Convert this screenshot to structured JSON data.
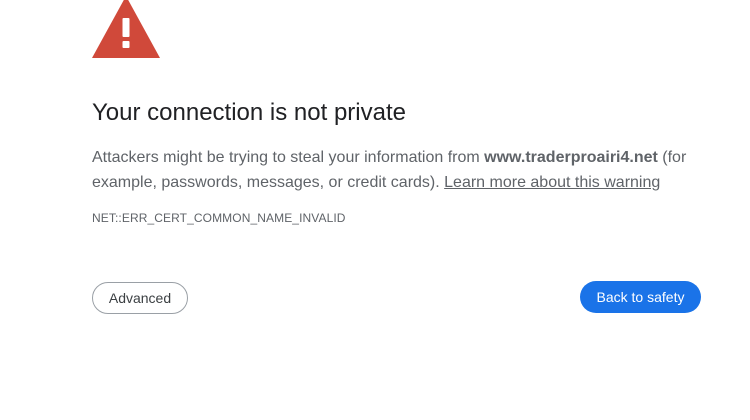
{
  "page": {
    "heading": "Your connection is not private",
    "message": {
      "text_before": "Attackers might be trying to steal your information from ",
      "hostname": "www.traderproairi4.net",
      "text_after": " (for example, passwords, messages, or credit cards). ",
      "learn_more_link": "Learn more about this warning"
    },
    "error_code": "NET::ERR_CERT_COMMON_NAME_INVALID",
    "buttons": {
      "advanced_label": "Advanced",
      "back_to_safety_label": "Back to safety"
    },
    "icon": "warning-triangle-icon"
  },
  "colors": {
    "warning_red": "#d0493a",
    "primary_blue": "#1a73e8",
    "text_dark": "#202124",
    "text_muted": "#5f6368"
  }
}
